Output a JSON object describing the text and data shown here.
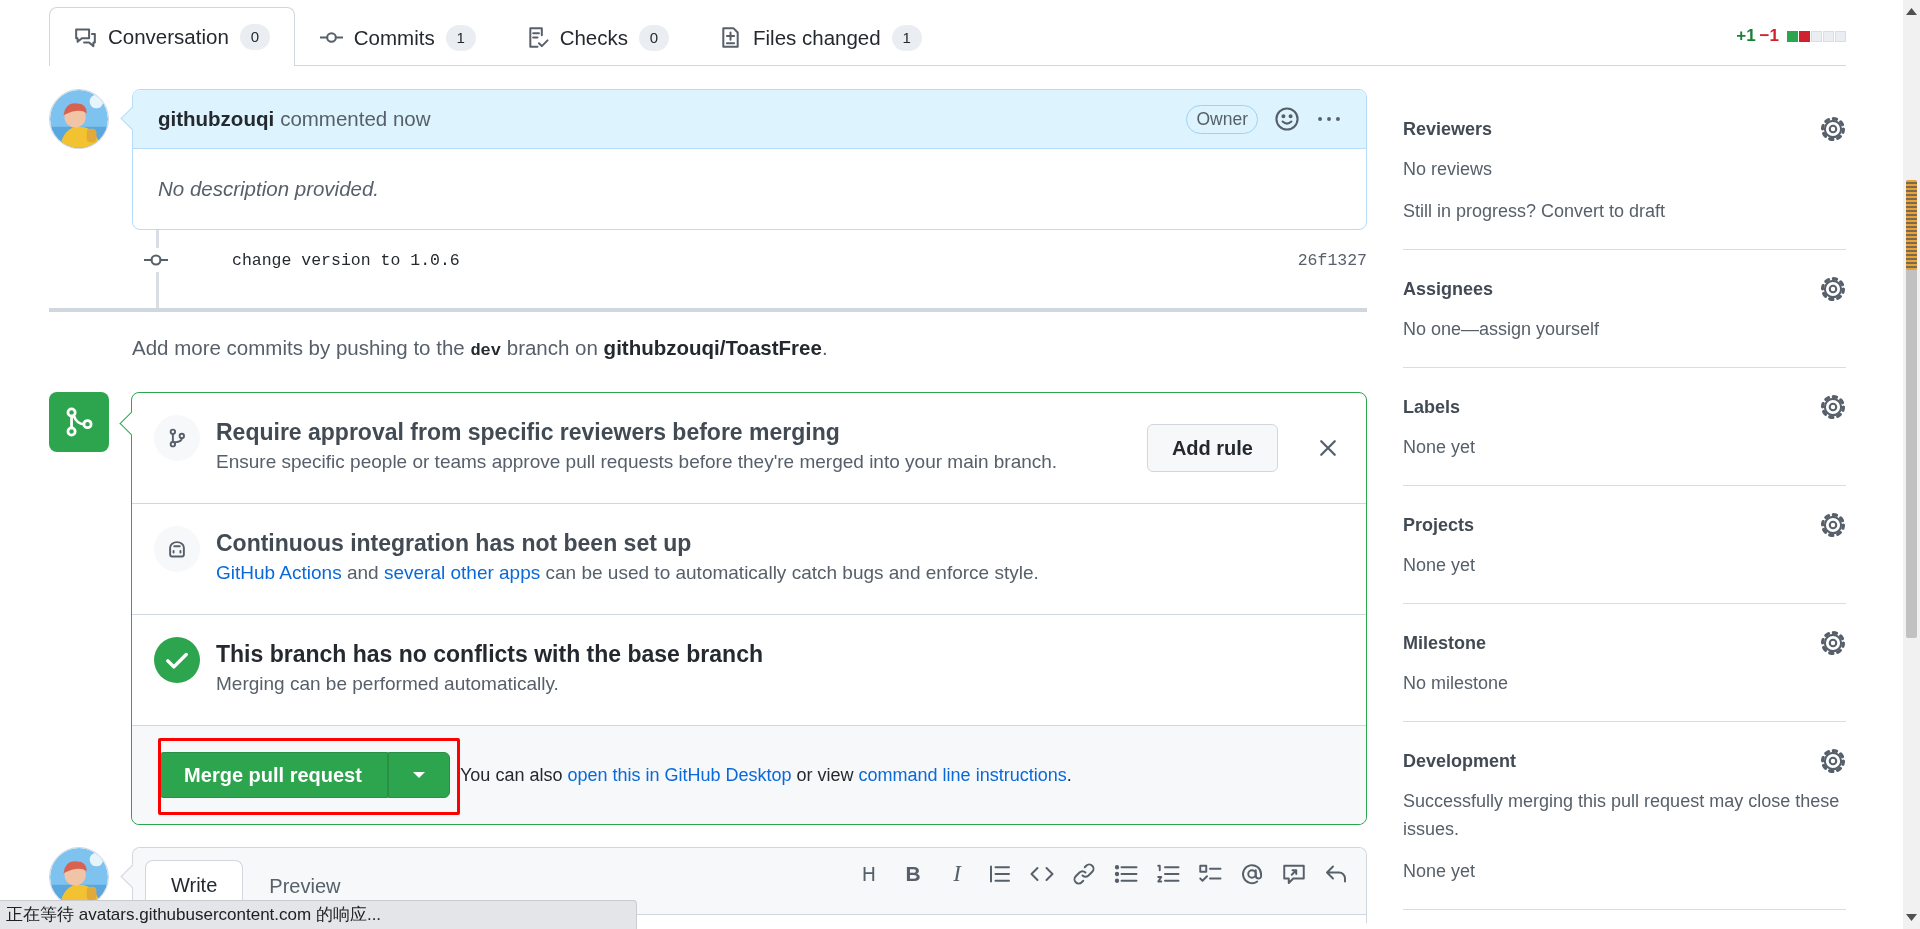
{
  "tabs": [
    {
      "label": "Conversation",
      "count": "0",
      "selected": true
    },
    {
      "label": "Commits",
      "count": "1",
      "selected": false
    },
    {
      "label": "Checks",
      "count": "0",
      "selected": false
    },
    {
      "label": "Files changed",
      "count": "1",
      "selected": false
    }
  ],
  "diffstat": {
    "additions": "+1",
    "deletions": "−1",
    "blocks": [
      {
        "kind": "added"
      },
      {
        "kind": "removed"
      },
      {
        "kind": "neutral"
      },
      {
        "kind": "neutral"
      },
      {
        "kind": "neutral"
      }
    ]
  },
  "comment": {
    "author": "githubzouqi",
    "action": "commented now",
    "badge": "Owner",
    "body": "No description provided."
  },
  "commits": [
    {
      "message": "change version to 1.0.6",
      "sha": "26f1327"
    }
  ],
  "push_hint": "Add more commits by pushing to the **dev** branch on **githubzouqi/ToastFree**.",
  "merge_box": {
    "sections": [
      {
        "kind": "rule",
        "title": "Require approval from specific reviewers before merging",
        "parts": [
          {
            "kind": "text",
            "text": "Ensure specific people or teams approve pull requests before they're merged into your main branch."
          }
        ],
        "button": "Add rule",
        "dismissible": true
      },
      {
        "kind": "ci",
        "title": "Continuous integration has not been set up",
        "parts": [
          {
            "kind": "link",
            "text": "GitHub Actions"
          },
          {
            "kind": "text",
            "text": " and "
          },
          {
            "kind": "link",
            "text": "several other apps"
          },
          {
            "kind": "text",
            "text": " can be used to automatically catch bugs and enforce style."
          }
        ],
        "dismissible": false
      },
      {
        "kind": "status",
        "title": "This branch has no conflicts with the base branch",
        "parts": [
          {
            "kind": "text",
            "text": "Merging can be performed automatically."
          }
        ],
        "dismissible": false
      }
    ],
    "merge_button": {
      "label": "Merge pull request",
      "highlighted": true
    },
    "hint_parts": [
      {
        "kind": "text",
        "text": "You can also "
      },
      {
        "kind": "link",
        "text": "open this in GitHub Desktop"
      },
      {
        "kind": "text",
        "text": " or view "
      },
      {
        "kind": "link",
        "text": "command line instructions"
      },
      {
        "kind": "text",
        "text": "."
      }
    ]
  },
  "composer": {
    "tabs": [
      {
        "label": "Write",
        "selected": true
      },
      {
        "label": "Preview",
        "selected": false
      }
    ],
    "toolbar": [
      {
        "kind": "heading",
        "label": "H"
      },
      {
        "kind": "bold",
        "label": "B"
      },
      {
        "kind": "italic",
        "label": "I"
      },
      {
        "kind": "quote"
      },
      {
        "kind": "code"
      },
      {
        "kind": "link"
      },
      {
        "kind": "unordered-list"
      },
      {
        "kind": "ordered-list"
      },
      {
        "kind": "task-list"
      },
      {
        "kind": "mention"
      },
      {
        "kind": "reference"
      },
      {
        "kind": "reply"
      }
    ]
  },
  "sidebar": [
    {
      "title": "Reviewers",
      "values": [
        "No reviews",
        "Still in progress? Convert to draft"
      ]
    },
    {
      "title": "Assignees",
      "values": [
        "No one—assign yourself"
      ]
    },
    {
      "title": "Labels",
      "values": [
        "None yet"
      ]
    },
    {
      "title": "Projects",
      "values": [
        "None yet"
      ]
    },
    {
      "title": "Milestone",
      "values": [
        "No milestone"
      ]
    },
    {
      "title": "Development",
      "values": [
        "Successfully merging this pull request may close these issues.",
        "None yet"
      ]
    }
  ],
  "status_bar": "正在等待 avatars.githubusercontent.com 的响应..."
}
